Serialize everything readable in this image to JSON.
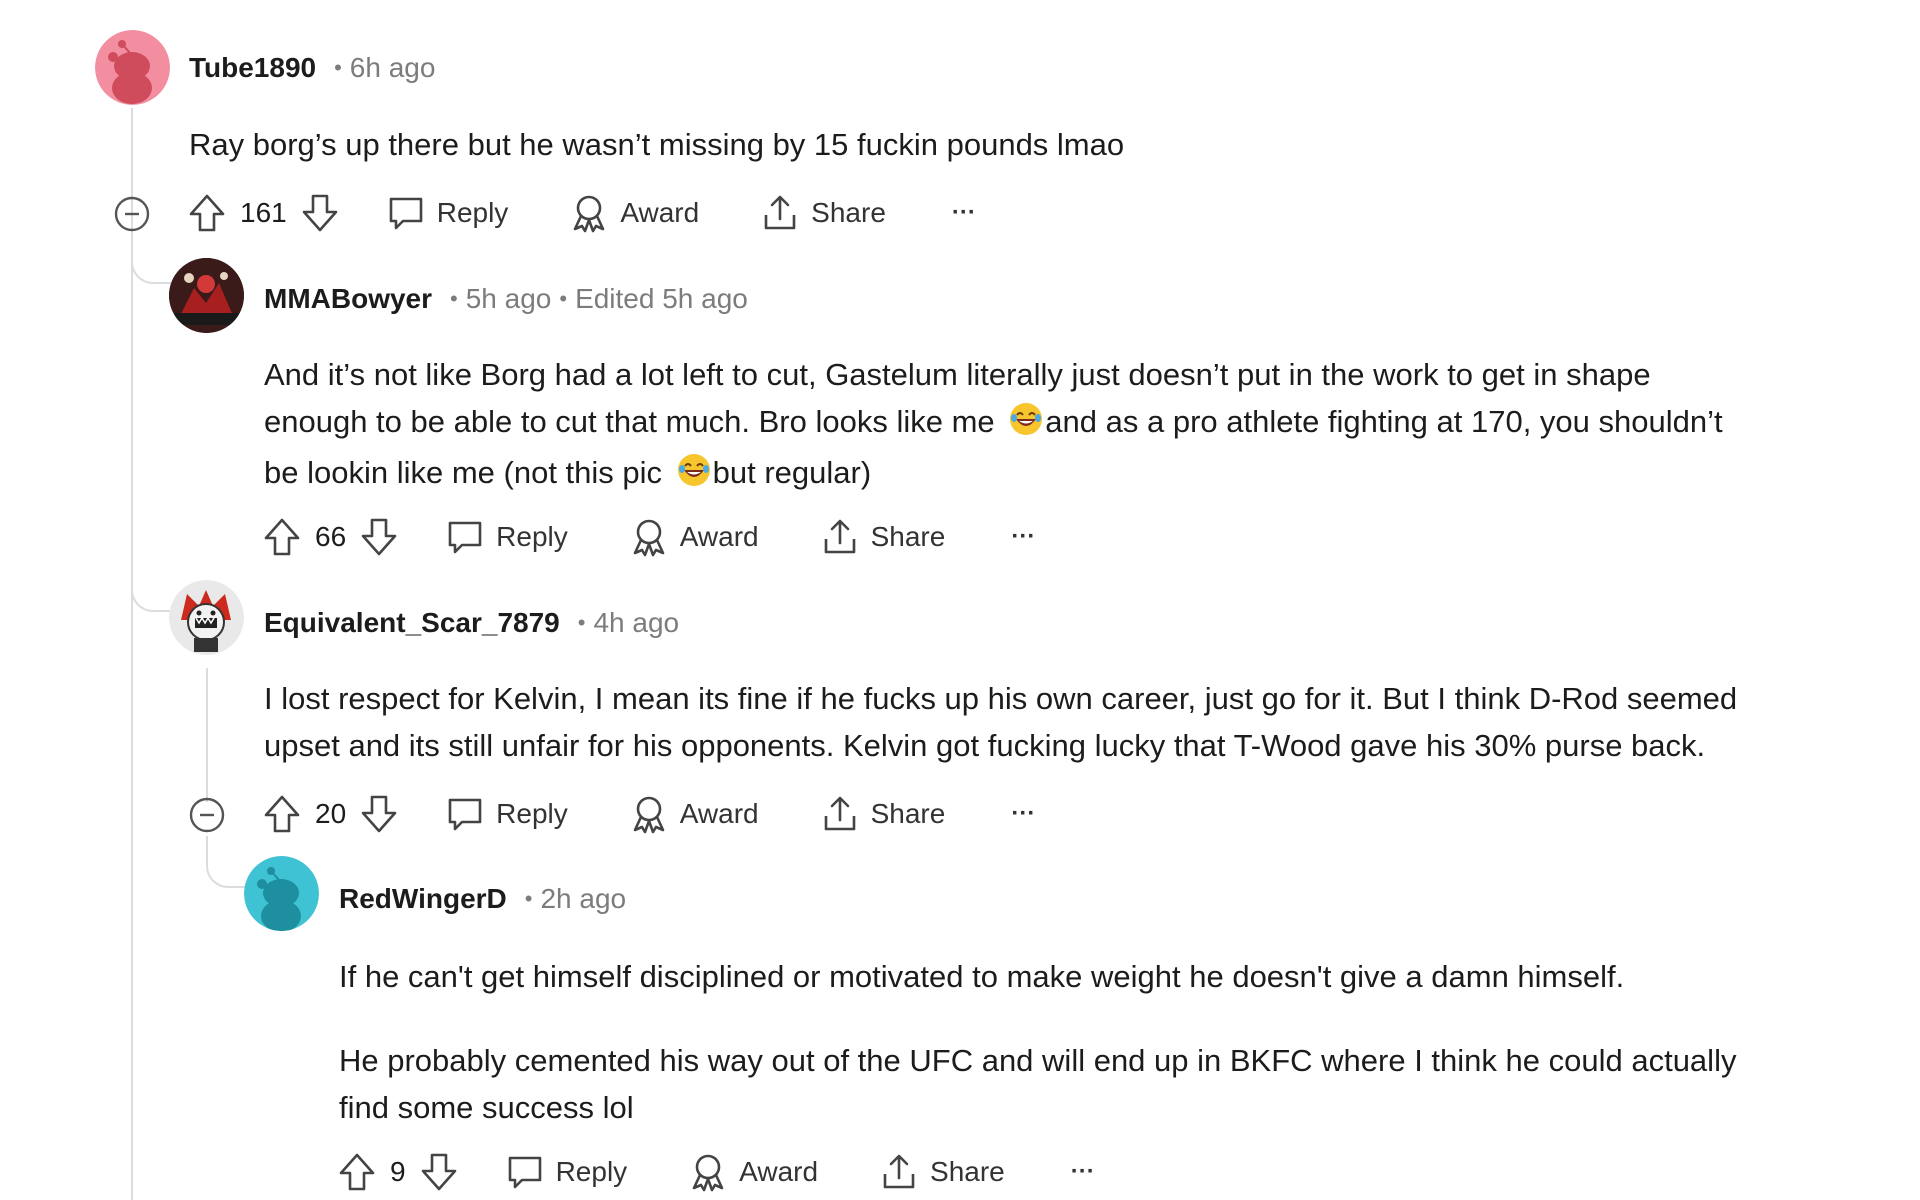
{
  "comments": [
    {
      "username": "Tube1890",
      "time": "6h ago",
      "avatar_color": "#f28ea0",
      "body": [
        "Ray borg’s up there but he wasn’t missing by 15 fuckin pounds lmao"
      ],
      "votes": "161",
      "actions": {
        "reply": "Reply",
        "award": "Award",
        "share": "Share",
        "more": "···"
      }
    },
    {
      "username": "MMABowyer",
      "time": "5h ago",
      "edited": "Edited 5h ago",
      "avatar_color": "#6b1515",
      "body_line1": "And it’s not like Borg had a lot left to cut, Gastelum literally just doesn’t put in the work to get in shape",
      "body_line2a": "enough to be able to cut that much. Bro looks like me",
      "body_line2b": "and as a pro athlete fighting at 170, you shouldn’t",
      "body_line3a": "be lookin like me (not this pic",
      "body_line3b": "but regular)",
      "emoji": "laughing-emoji",
      "votes": "66",
      "actions": {
        "reply": "Reply",
        "award": "Award",
        "share": "Share",
        "more": "···"
      }
    },
    {
      "username": "Equivalent_Scar_7879",
      "time": "4h ago",
      "avatar_color": "#cc2a1f",
      "body_line1": "I lost respect for Kelvin, I mean its fine if he fucks up his own career, just go for it. But I think D-Rod seemed",
      "body_line2": "upset and its still unfair for his opponents. Kelvin got fucking lucky that T-Wood gave his 30% purse back.",
      "votes": "20",
      "actions": {
        "reply": "Reply",
        "award": "Award",
        "share": "Share",
        "more": "···"
      }
    },
    {
      "username": "RedWingerD",
      "time": "2h ago",
      "avatar_color": "#3fc2d3",
      "body_p1": "If he can't get himself disciplined or motivated to make weight he doesn't give a damn himself.",
      "body_p2_line1": "He probably cemented his way out of the UFC and will end up in BKFC where I think he could actually",
      "body_p2_line2": "find some success lol",
      "votes": "9",
      "actions": {
        "reply": "Reply",
        "award": "Award",
        "share": "Share",
        "more": "···"
      }
    }
  ],
  "icons": {
    "upvote": "upvote-arrow-icon",
    "downvote": "downvote-arrow-icon",
    "reply": "speech-bubble-icon",
    "award": "award-ribbon-icon",
    "share": "share-upload-icon",
    "collapse": "collapse-minus-icon"
  }
}
